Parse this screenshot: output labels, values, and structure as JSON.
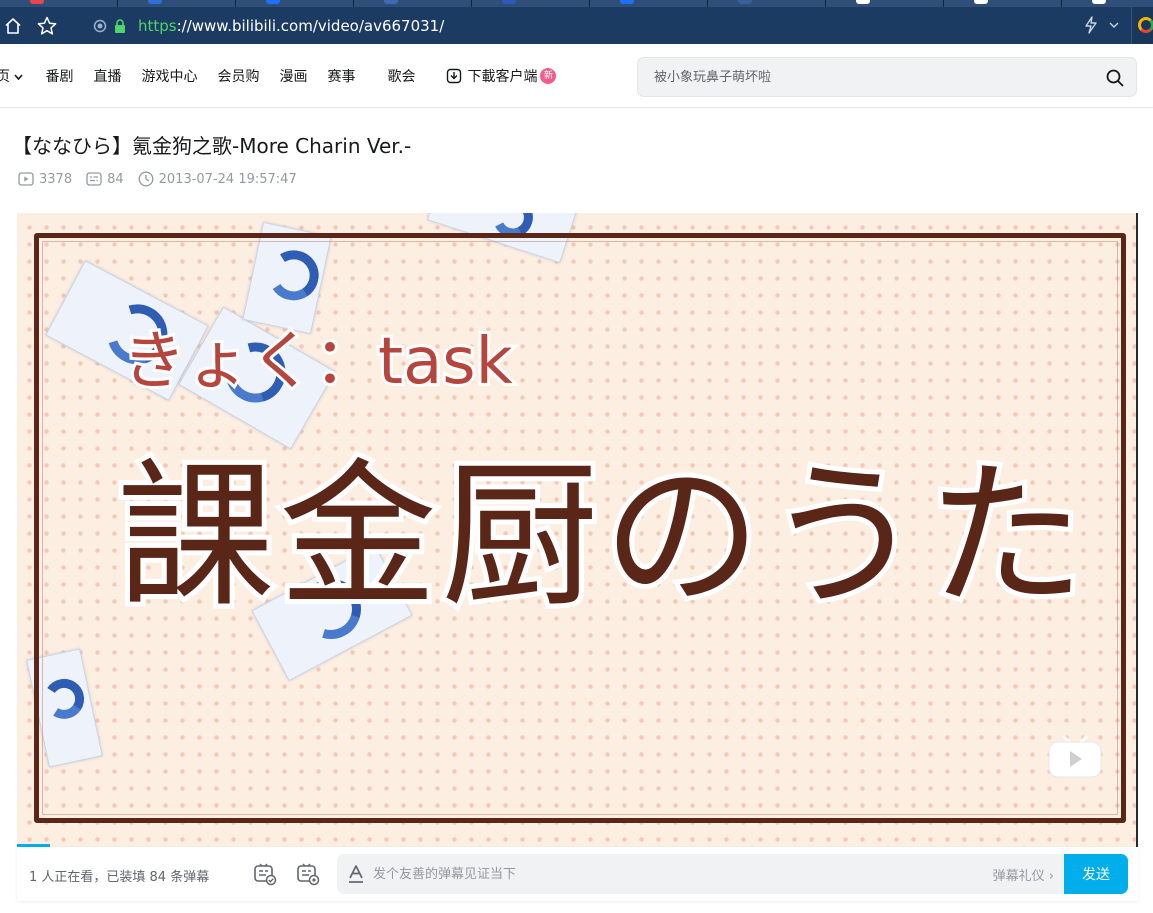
{
  "browser": {
    "url_scheme": "https",
    "url_rest": "://www.bilibili.com/video/av667031/"
  },
  "header": {
    "nav_items": [
      {
        "id": "home",
        "label": "页",
        "has_dropdown": true
      },
      {
        "id": "anime",
        "label": "番剧"
      },
      {
        "id": "live",
        "label": "直播"
      },
      {
        "id": "game",
        "label": "游戏中心"
      },
      {
        "id": "mall",
        "label": "会员购"
      },
      {
        "id": "manga",
        "label": "漫画"
      },
      {
        "id": "match",
        "label": "赛事"
      },
      {
        "id": "concert",
        "label": "歌会"
      }
    ],
    "download_label": "下載客户端",
    "download_badge": "新",
    "search_placeholder": "被小象玩鼻子萌坏啦"
  },
  "video": {
    "title": "【ななひら】氪金狗之歌-More Charin Ver.-",
    "views": "3378",
    "danmaku_count": "84",
    "publish_time": "2013-07-24 19:57:47",
    "frame_text_small": "きょく：task",
    "frame_text_large": "課金厨のうた"
  },
  "danmaku_bar": {
    "info": "1 人正在看，已装填 84 条弹幕",
    "input_placeholder": "发个友善的弹幕见证当下",
    "etiquette_label": "弹幕礼仪 ›",
    "send_label": "发送"
  },
  "colors": {
    "accent": "#00aeec",
    "badge": "#f25d8e",
    "frame_border": "#5a2618",
    "chrome": "#1c3b63"
  }
}
